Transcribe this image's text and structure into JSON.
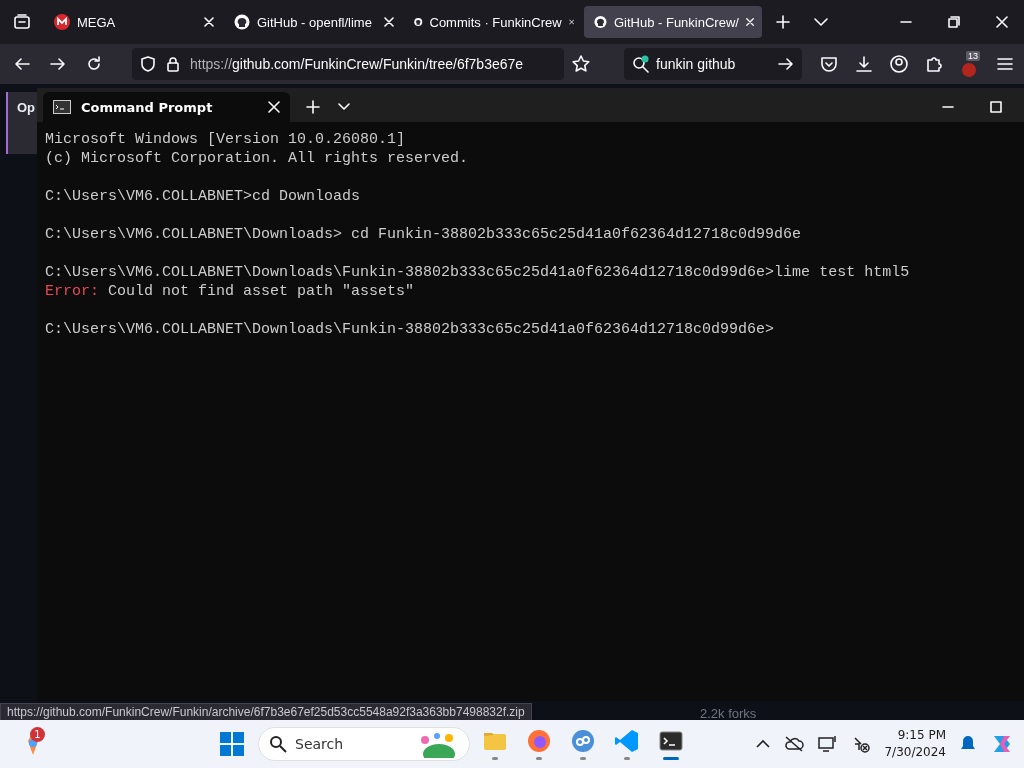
{
  "browser": {
    "tabs": [
      {
        "title": "MEGA",
        "kind": "mega",
        "selected": false
      },
      {
        "title": "GitHub - openfl/lime",
        "kind": "github",
        "selected": false
      },
      {
        "title": "Commits · FunkinCrew",
        "kind": "github",
        "selected": false
      },
      {
        "title": "GitHub - FunkinCrew/",
        "kind": "github",
        "selected": true
      }
    ],
    "url": "https://github.com/FunkinCrew/Funkin/tree/6f7b3e67e",
    "search": "funkin github",
    "extension_badge": "13",
    "page_fragment": "Op",
    "forks": "2.2k forks",
    "status_url": "https://github.com/FunkinCrew/Funkin/archive/6f7b3e67ef25d53cc5548a92f3a363bb7498832f.zip"
  },
  "terminal": {
    "title": "Command Prompt",
    "lines": [
      {
        "kind": "text",
        "text": "Microsoft Windows [Version 10.0.26080.1]"
      },
      {
        "kind": "text",
        "text": "(c) Microsoft Corporation. All rights reserved."
      },
      {
        "kind": "blank"
      },
      {
        "kind": "text",
        "text": "C:\\Users\\VM6.COLLABNET>cd Downloads"
      },
      {
        "kind": "blank"
      },
      {
        "kind": "text",
        "text": "C:\\Users\\VM6.COLLABNET\\Downloads> cd Funkin-38802b333c65c25d41a0f62364d12718c0d99d6e"
      },
      {
        "kind": "blank"
      },
      {
        "kind": "text",
        "text": "C:\\Users\\VM6.COLLABNET\\Downloads\\Funkin-38802b333c65c25d41a0f62364d12718c0d99d6e>lime test html5"
      },
      {
        "kind": "error",
        "label": "Error:",
        "text": " Could not find asset path \"assets\""
      },
      {
        "kind": "blank"
      },
      {
        "kind": "text",
        "text": "C:\\Users\\VM6.COLLABNET\\Downloads\\Funkin-38802b333c65c25d41a0f62364d12718c0d99d6e>"
      }
    ]
  },
  "taskbar": {
    "widget_badge": "1",
    "search_placeholder": "Search",
    "apps": [
      {
        "kind": "folder",
        "running": true,
        "selected": false
      },
      {
        "kind": "firefox",
        "running": true,
        "selected": false
      },
      {
        "kind": "qb",
        "running": true,
        "selected": false
      },
      {
        "kind": "vscode",
        "running": true,
        "selected": false
      },
      {
        "kind": "terminal",
        "running": true,
        "selected": true
      }
    ],
    "time": "9:15 PM",
    "date": "7/30/2024"
  }
}
